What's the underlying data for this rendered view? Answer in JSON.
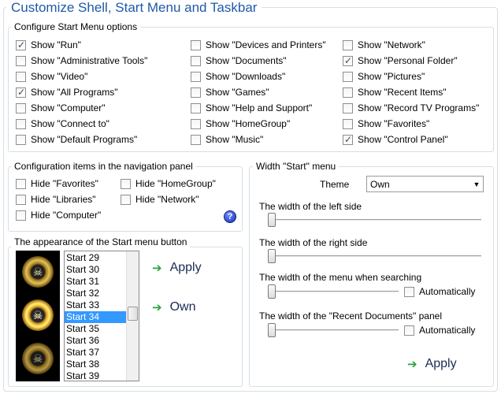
{
  "title": "Customize Shell, Start Menu and Taskbar",
  "start_menu_options": {
    "legend": "Configure Start Menu options",
    "columns": [
      [
        {
          "label": "Show \"Run\"",
          "checked": true
        },
        {
          "label": "Show \"Administrative Tools\"",
          "checked": false
        },
        {
          "label": "Show \"Video\"",
          "checked": false
        },
        {
          "label": "Show \"All Programs\"",
          "checked": true
        },
        {
          "label": "Show \"Computer\"",
          "checked": false
        },
        {
          "label": "Show \"Connect to\"",
          "checked": false
        },
        {
          "label": "Show \"Default Programs\"",
          "checked": false
        }
      ],
      [
        {
          "label": "Show \"Devices and Printers\"",
          "checked": false
        },
        {
          "label": "Show \"Documents\"",
          "checked": false
        },
        {
          "label": "Show \"Downloads\"",
          "checked": false
        },
        {
          "label": "Show \"Games\"",
          "checked": false
        },
        {
          "label": "Show \"Help and Support\"",
          "checked": false
        },
        {
          "label": "Show \"HomeGroup\"",
          "checked": false
        },
        {
          "label": "Show \"Music\"",
          "checked": false
        }
      ],
      [
        {
          "label": "Show \"Network\"",
          "checked": false
        },
        {
          "label": "Show \"Personal Folder\"",
          "checked": true
        },
        {
          "label": "Show \"Pictures\"",
          "checked": false
        },
        {
          "label": "Show \"Recent Items\"",
          "checked": false
        },
        {
          "label": "Show \"Record TV Programs\"",
          "checked": false
        },
        {
          "label": "Show \"Favorites\"",
          "checked": false
        },
        {
          "label": "Show \"Control Panel\"",
          "checked": true
        }
      ]
    ]
  },
  "nav_panel": {
    "legend": "Configuration items in the navigation panel",
    "items": [
      {
        "label": "Hide \"Favorites\"",
        "checked": false
      },
      {
        "label": "Hide \"HomeGroup\"",
        "checked": false
      },
      {
        "label": "Hide \"Libraries\"",
        "checked": false
      },
      {
        "label": "Hide \"Network\"",
        "checked": false
      },
      {
        "label": "Hide \"Computer\"",
        "checked": false
      }
    ],
    "help_glyph": "?"
  },
  "start_button": {
    "legend": "The appearance of the Start menu button",
    "list": [
      "Start 29",
      "Start 30",
      "Start 31",
      "Start 32",
      "Start 33",
      "Start 34",
      "Start 35",
      "Start 36",
      "Start 37",
      "Start 38",
      "Start 39"
    ],
    "selected": "Start 34",
    "apply_label": "Apply",
    "own_label": "Own",
    "orb_glyph": "☠"
  },
  "width_menu": {
    "legend": "Width \"Start\" menu",
    "theme_label": "Theme",
    "theme_value": "Own",
    "left_label": "The width of the left side",
    "right_label": "The width of the right side",
    "search_label": "The width of the menu when searching",
    "recent_label": "The width of the \"Recent Documents\" panel",
    "auto_label": "Automatically",
    "apply_label": "Apply",
    "slider_values": {
      "left": 0,
      "right": 0,
      "search": 0,
      "recent": 0
    }
  }
}
